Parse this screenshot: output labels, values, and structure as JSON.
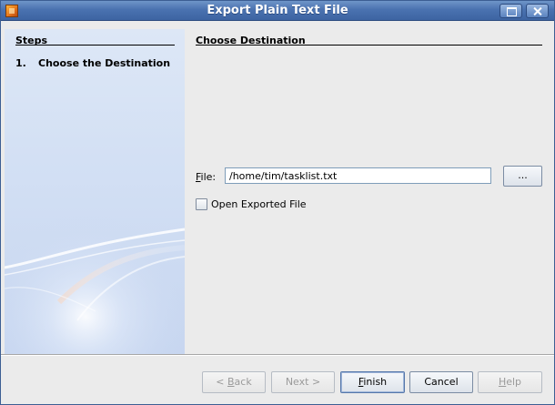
{
  "window": {
    "title": "Export Plain Text File"
  },
  "steps": {
    "heading": "Steps",
    "items": [
      {
        "number": "1.",
        "label": "Choose the Destination"
      }
    ]
  },
  "content": {
    "heading": "Choose Destination",
    "file_label_mnemonic": "F",
    "file_label_rest": "ile:",
    "file_value": "/home/tim/tasklist.txt",
    "browse_label": "...",
    "open_exported_label": "Open Exported File",
    "open_exported_checked": false
  },
  "footer": {
    "back_prefix": "< ",
    "back_mnemonic": "B",
    "back_rest": "ack",
    "next_label": "Next >",
    "finish_mnemonic": "F",
    "finish_rest": "inish",
    "cancel_label": "Cancel",
    "help_mnemonic": "H",
    "help_rest": "elp"
  },
  "colors": {
    "titlebar": "#4a72b0",
    "steps_panel": "#d3e0f4",
    "content_bg": "#ebebeb"
  },
  "icons": [
    "app-icon",
    "maximize-icon",
    "close-icon"
  ]
}
